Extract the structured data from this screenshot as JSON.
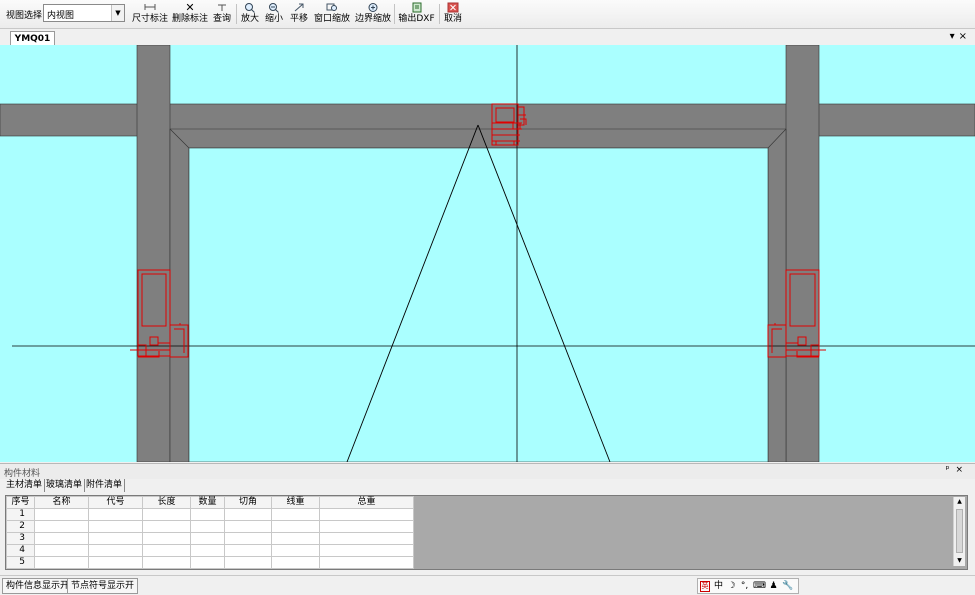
{
  "toolbar": {
    "view_select_label": "视图选择",
    "view_select_value": "内视图",
    "buttons": [
      {
        "label": "尺寸标注",
        "icon": "dimension-icon"
      },
      {
        "label": "删除标注",
        "icon": "delete-x-icon"
      },
      {
        "label": "查询",
        "icon": "query-icon"
      },
      {
        "label": "放大",
        "icon": "zoom-in-icon"
      },
      {
        "label": "缩小",
        "icon": "zoom-out-icon"
      },
      {
        "label": "平移",
        "icon": "pan-icon"
      },
      {
        "label": "窗口缩放",
        "icon": "window-zoom-icon"
      },
      {
        "label": "边界缩放",
        "icon": "extent-zoom-icon"
      },
      {
        "label": "输出DXF",
        "icon": "export-dxf-icon"
      },
      {
        "label": "取消",
        "icon": "cancel-icon"
      }
    ]
  },
  "document_tabs": [
    {
      "label": "YMQ01",
      "active": true
    }
  ],
  "tab_controls": {
    "dropdown": "▾",
    "close": "×"
  },
  "canvas": {
    "background_color": "#aaffff",
    "frame_color": "#7f7f7f",
    "profile_color": "#e00000",
    "line_color": "#000000"
  },
  "panel": {
    "title": "构件材料",
    "controls": {
      "pin": "ᵖ",
      "close": "×"
    },
    "tabs": [
      "主材清单",
      "玻璃清单",
      "附件清单"
    ],
    "table": {
      "columns": [
        "序号",
        "名称",
        "代号",
        "长度",
        "数量",
        "切角",
        "线重",
        "总重"
      ],
      "row_numbers": [
        "1",
        "2",
        "3",
        "4",
        "5"
      ]
    }
  },
  "statusbar": {
    "buttons": [
      "构件信息显示开",
      "节点符号显示开"
    ],
    "ime": [
      "英",
      "中",
      "☽",
      "°,",
      "⌨",
      "♟",
      "🔧"
    ]
  }
}
